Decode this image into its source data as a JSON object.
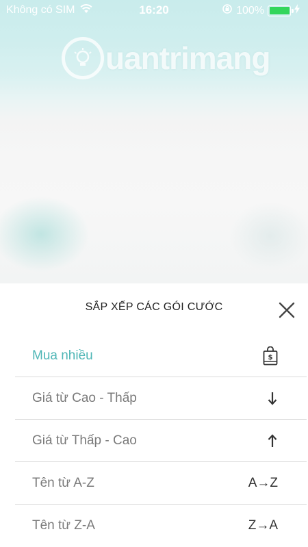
{
  "status_bar": {
    "carrier": "Không có SIM",
    "time": "16:20",
    "battery_percent": "100%",
    "battery_level": 1.0,
    "battery_color": "#33d65c"
  },
  "watermark": {
    "text": "uantrimang"
  },
  "sheet": {
    "title": "SẮP XẾP CÁC GÓI CƯỚC",
    "accent_color": "#4fb6b6",
    "options": [
      {
        "label": "Mua nhiều",
        "icon": "shopping-bag-icon",
        "active": true
      },
      {
        "label": "Giá từ Cao - Thấp",
        "icon": "arrow-down-icon",
        "active": false
      },
      {
        "label": "Giá từ Thấp - Cao",
        "icon": "arrow-up-icon",
        "active": false
      },
      {
        "label": "Tên từ A-Z",
        "icon_text": "A→Z",
        "icon": "a-to-z-icon",
        "active": false
      },
      {
        "label": "Tên từ Z-A",
        "icon_text": "Z→A",
        "icon": "z-to-a-icon",
        "active": false
      }
    ]
  }
}
